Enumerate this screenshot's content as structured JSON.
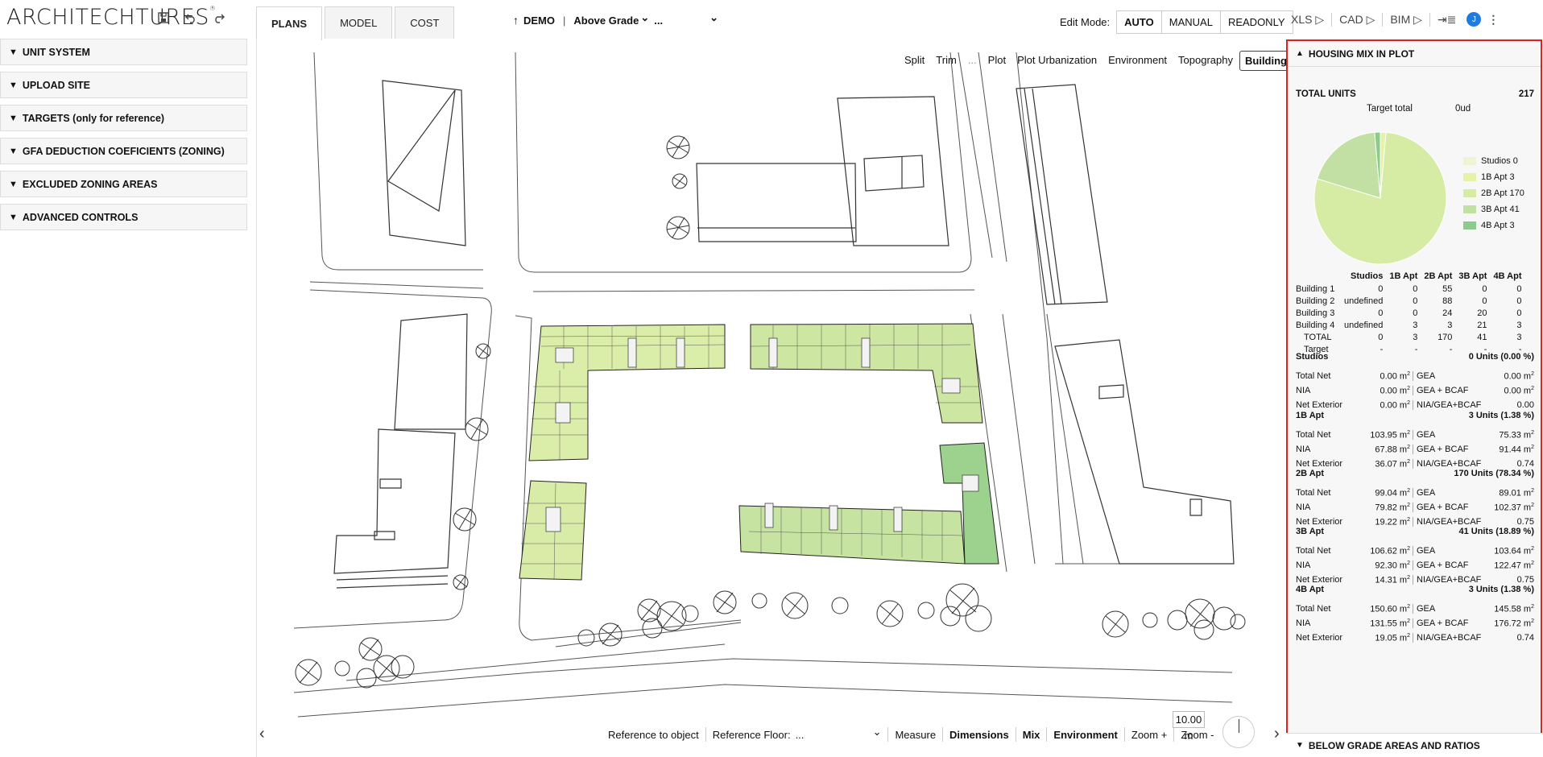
{
  "app": {
    "logo": "ARCHITECHTURES",
    "logo_mark": "®"
  },
  "toolbar": {
    "save_icon": "save-icon",
    "undo_icon": "undo-icon",
    "redo_icon": "redo-icon"
  },
  "tabs": [
    {
      "label": "PLANS",
      "active": true
    },
    {
      "label": "MODEL",
      "active": false
    },
    {
      "label": "COST",
      "active": false
    }
  ],
  "topnav": {
    "arrow": "↑",
    "project": "DEMO",
    "divider": "|",
    "grade": "Above Grade",
    "grade_chev": "⌄",
    "ellipsis": "...",
    "dropdown": "⌄"
  },
  "edit_mode": {
    "label": "Edit Mode:",
    "options": [
      "AUTO",
      "MANUAL",
      "READONLY"
    ],
    "selected": "AUTO"
  },
  "exports": [
    {
      "label": "XLS ▷"
    },
    {
      "label": "CAD ▷"
    },
    {
      "label": "BIM ▷"
    },
    {
      "label": "⇥≣"
    }
  ],
  "user": {
    "avatar_initial": "J",
    "menu": "⋮"
  },
  "left_panel": {
    "sections": [
      "UNIT SYSTEM",
      "UPLOAD SITE",
      "TARGETS (only for reference)",
      "GFA DEDUCTION COEFICIENTS (ZONING)",
      "EXCLUDED ZONING AREAS",
      "ADVANCED CONTROLS"
    ]
  },
  "view_tabs": {
    "items": [
      "Split",
      "Trim",
      "...",
      "Plot",
      "Plot Urbanization",
      "Environment",
      "Topography",
      "Building"
    ],
    "selected": "Building"
  },
  "bottom_bar": {
    "reference_object": "Reference to object",
    "reference_floor": "Reference Floor:",
    "floor_value": "...",
    "floor_chev": "⌄",
    "measure": "Measure",
    "dimensions": "Dimensions",
    "mix": "Mix",
    "environment": "Environment",
    "zoom_in": "Zoom +",
    "zoom_out": "Zoom -"
  },
  "scale": {
    "value": "10.00",
    "unit": "m"
  },
  "nav": {
    "prev": "‹",
    "next": "›"
  },
  "housing_mix": {
    "title": "HOUSING MIX IN PLOT",
    "total_units_label": "TOTAL UNITS",
    "total_units": "217",
    "target_label": "Target total",
    "target_value": "0ud",
    "legend": [
      {
        "label": "Studios 0",
        "value": 0,
        "color": "#eef5d6"
      },
      {
        "label": "1B Apt 3",
        "value": 3,
        "color": "#e6f3a6"
      },
      {
        "label": "2B Apt 170",
        "value": 170,
        "color": "#d6eba4"
      },
      {
        "label": "3B Apt 41",
        "value": 41,
        "color": "#c3e0a4"
      },
      {
        "label": "4B Apt 3",
        "value": 3,
        "color": "#8bcb8b"
      }
    ],
    "table_headers": [
      "",
      "Studios",
      "1B Apt",
      "2B Apt",
      "3B Apt",
      "4B Apt"
    ],
    "table_rows": [
      [
        "Building 1",
        "0",
        "0",
        "55",
        "0",
        "0"
      ],
      [
        "Building 2",
        "undefined",
        "0",
        "88",
        "0",
        "0"
      ],
      [
        "Building 3",
        "0",
        "0",
        "24",
        "20",
        "0"
      ],
      [
        "Building 4",
        "undefined",
        "3",
        "3",
        "21",
        "3"
      ],
      [
        "TOTAL",
        "0",
        "3",
        "170",
        "41",
        "3"
      ],
      [
        "Target",
        "-",
        "-",
        "-",
        "-",
        "-"
      ]
    ],
    "units": [
      {
        "name": "Studios",
        "summary": "0 Units (0.00 %)",
        "rows": [
          [
            "Total Net",
            "0.00 m",
            "GEA",
            "0.00 m"
          ],
          [
            "NIA",
            "0.00 m",
            "GEA + BCAF",
            "0.00 m"
          ],
          [
            "Net Exterior",
            "0.00 m",
            "NIA/GEA+BCAF",
            "0.00"
          ]
        ]
      },
      {
        "name": "1B Apt",
        "summary": "3 Units (1.38 %)",
        "rows": [
          [
            "Total Net",
            "103.95 m",
            "GEA",
            "75.33 m"
          ],
          [
            "NIA",
            "67.88 m",
            "GEA + BCAF",
            "91.44 m"
          ],
          [
            "Net Exterior",
            "36.07 m",
            "NIA/GEA+BCAF",
            "0.74"
          ]
        ]
      },
      {
        "name": "2B Apt",
        "summary": "170 Units (78.34 %)",
        "rows": [
          [
            "Total Net",
            "99.04 m",
            "GEA",
            "89.01 m"
          ],
          [
            "NIA",
            "79.82 m",
            "GEA + BCAF",
            "102.37 m"
          ],
          [
            "Net Exterior",
            "19.22 m",
            "NIA/GEA+BCAF",
            "0.75"
          ]
        ]
      },
      {
        "name": "3B Apt",
        "summary": "41 Units (18.89 %)",
        "rows": [
          [
            "Total Net",
            "106.62 m",
            "GEA",
            "103.64 m"
          ],
          [
            "NIA",
            "92.30 m",
            "GEA + BCAF",
            "122.47 m"
          ],
          [
            "Net Exterior",
            "14.31 m",
            "NIA/GEA+BCAF",
            "0.75"
          ]
        ]
      },
      {
        "name": "4B Apt",
        "summary": "3 Units (1.38 %)",
        "rows": [
          [
            "Total Net",
            "150.60 m",
            "GEA",
            "145.58 m"
          ],
          [
            "NIA",
            "131.55 m",
            "GEA + BCAF",
            "176.72 m"
          ],
          [
            "Net Exterior",
            "19.05 m",
            "NIA/GEA+BCAF",
            "0.74"
          ]
        ]
      }
    ],
    "area_exponent": "2"
  },
  "below_grade": {
    "title": "BELOW GRADE AREAS AND RATIOS"
  }
}
